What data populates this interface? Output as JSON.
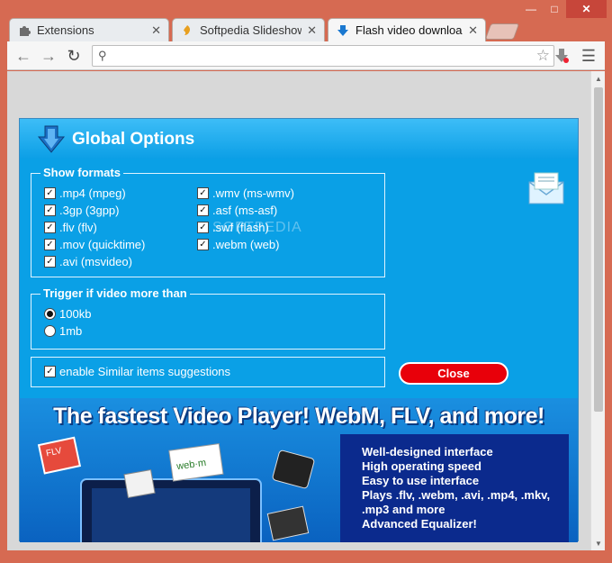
{
  "tabs": [
    {
      "title": "Extensions",
      "icon": "puzzle-icon"
    },
    {
      "title": "Softpedia Slideshow - \\",
      "icon": "softpedia-icon"
    },
    {
      "title": "Flash video downloadе",
      "icon": "download-arrow-icon"
    }
  ],
  "toolbar": {
    "url_value": "",
    "url_placeholder": ""
  },
  "dialog": {
    "title": "Global Options",
    "formats_group_title": "Show formats",
    "formats": [
      {
        "label": ".mp4 (mpeg)",
        "checked": true
      },
      {
        "label": ".3gp (3gpp)",
        "checked": true
      },
      {
        "label": ".flv (flv)",
        "checked": true
      },
      {
        "label": ".mov (quicktime)",
        "checked": true
      },
      {
        "label": ".avi (msvideo)",
        "checked": true
      },
      {
        "label": ".wmv (ms-wmv)",
        "checked": true
      },
      {
        "label": ".asf (ms-asf)",
        "checked": true
      },
      {
        "label": ".swf (flash)",
        "checked": true
      },
      {
        "label": ".webm (web)",
        "checked": true
      }
    ],
    "trigger_group_title": "Trigger if video more than",
    "trigger_options": [
      {
        "label": "100kb",
        "selected": true
      },
      {
        "label": "1mb",
        "selected": false
      }
    ],
    "similar_label": "enable Similar items suggestions",
    "similar_checked": true,
    "close_label": "Close"
  },
  "banner": {
    "headline": "The fastest Video Player! WebM, FLV, and more!",
    "features": [
      "Well-designed interface",
      "High operating speed",
      "Easy to use interface",
      "Plays .flv, .webm, .avi, .mp4, .mkv,",
      ".mp3 and more",
      "Advanced Equalizer!"
    ],
    "art_labels": {
      "flv": "FLV",
      "webm": "web·m"
    }
  },
  "watermark": "SOFTPEDIA",
  "colors": {
    "frame": "#d66a52",
    "dialog_bg": "#0aa0e6",
    "close_button": "#e8000a",
    "features_bg": "#0b2a8d"
  }
}
